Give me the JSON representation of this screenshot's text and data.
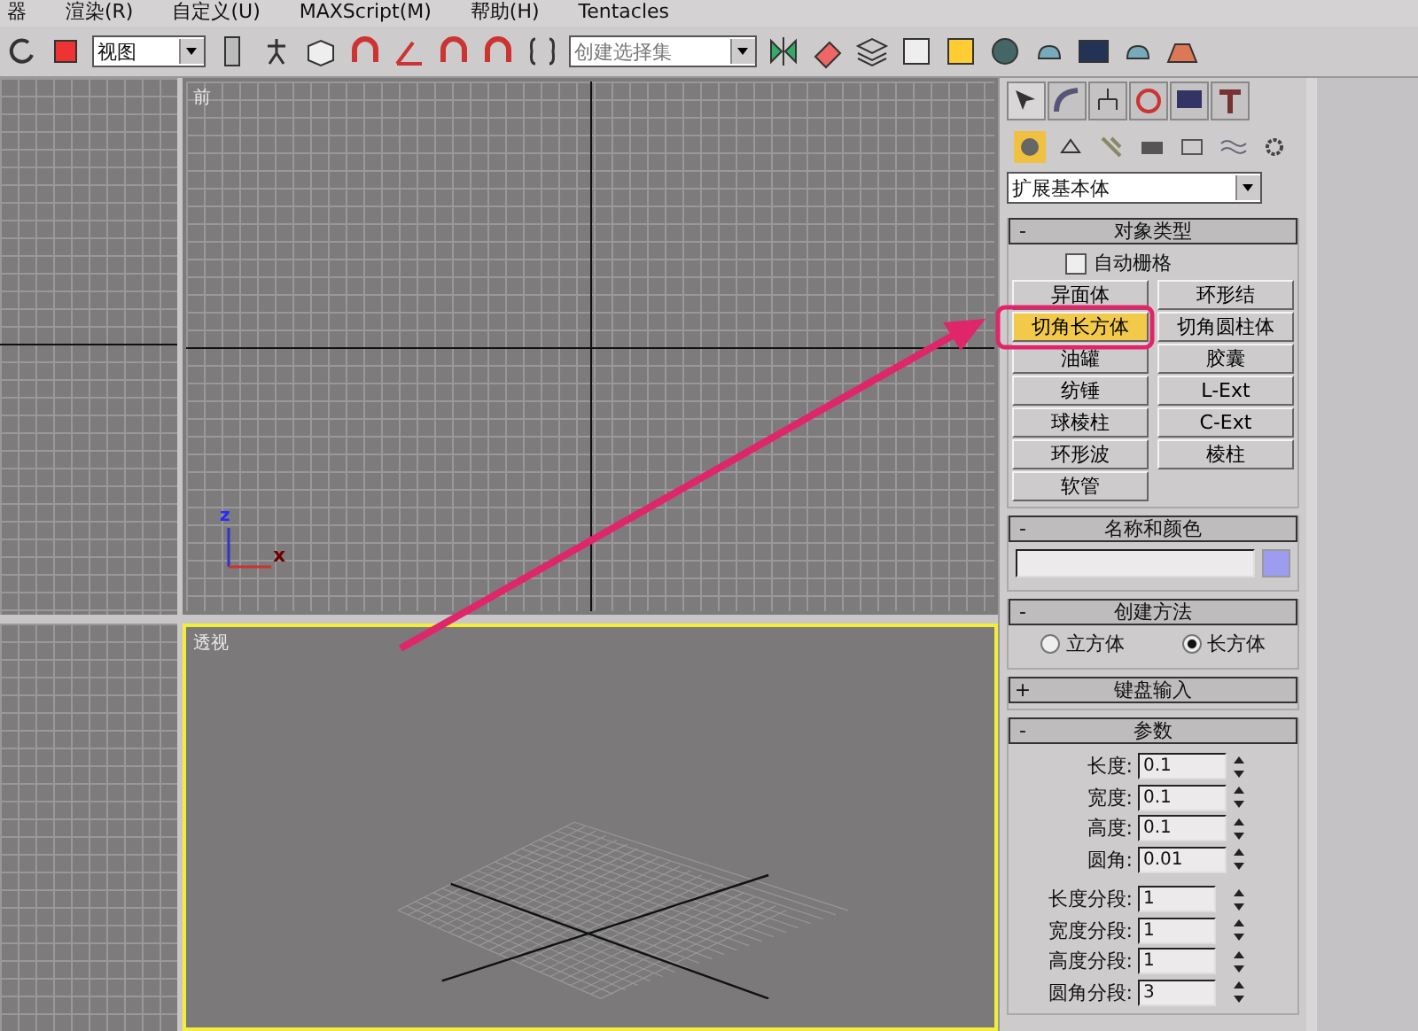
{
  "menu_bar": [
    "器",
    "渲染(R)",
    "自定义(U)",
    "MAXScript(M)",
    "帮助(H)",
    "Tentacles"
  ],
  "toolbar": {
    "view_dropdown": "视图",
    "selection_set_placeholder": "创建选择集"
  },
  "viewports": [
    {
      "label": "前",
      "active": false,
      "axis_labels": [
        "z",
        "x"
      ]
    },
    {
      "label": "透视",
      "active": true
    }
  ],
  "command_panel": {
    "tabs": [
      {
        "selected": true
      },
      {
        "selected": false
      },
      {
        "selected": false
      },
      {
        "selected": false
      },
      {
        "selected": false
      },
      {
        "selected": false
      }
    ],
    "categories": [
      {
        "selected": true
      },
      {
        "selected": false
      },
      {
        "selected": false
      },
      {
        "selected": false
      },
      {
        "selected": false
      },
      {
        "selected": false
      },
      {
        "selected": false
      }
    ],
    "dropdown": "扩展基本体",
    "rollouts": [
      {
        "kind": "object_type",
        "toggle": "-",
        "title": "对象类型",
        "autogrid": {
          "label": "自动栅格",
          "checked": false
        },
        "buttons": [
          {
            "label": "异面体",
            "selected": false
          },
          {
            "label": "环形结",
            "selected": false
          },
          {
            "label": "切角长方体",
            "selected": true
          },
          {
            "label": "切角圆柱体",
            "selected": false
          },
          {
            "label": "油罐",
            "selected": false
          },
          {
            "label": "胶囊",
            "selected": false
          },
          {
            "label": "纺锤",
            "selected": false
          },
          {
            "label": "L-Ext",
            "selected": false
          },
          {
            "label": "球棱柱",
            "selected": false
          },
          {
            "label": "C-Ext",
            "selected": false
          },
          {
            "label": "环形波",
            "selected": false
          },
          {
            "label": "棱柱",
            "selected": false
          },
          {
            "label": "软管",
            "selected": false
          }
        ]
      },
      {
        "kind": "name_color",
        "toggle": "-",
        "title": "名称和颜色",
        "color": "#9c9cf0"
      },
      {
        "kind": "creation_method",
        "toggle": "-",
        "title": "创建方法",
        "options": [
          {
            "label": "立方体",
            "selected": false
          },
          {
            "label": "长方体",
            "selected": true
          }
        ]
      },
      {
        "kind": "collapsed",
        "toggle": "+",
        "title": "键盘输入"
      },
      {
        "kind": "parameters",
        "toggle": "-",
        "title": "参数",
        "fields": [
          {
            "label": "长度:",
            "value": "0.1"
          },
          {
            "label": "宽度:",
            "value": "0.1"
          },
          {
            "label": "高度:",
            "value": "0.1"
          },
          {
            "label": "圆角:",
            "value": "0.01"
          }
        ],
        "segments": [
          {
            "label": "长度分段:",
            "value": "1"
          },
          {
            "label": "宽度分段:",
            "value": "1"
          },
          {
            "label": "高度分段:",
            "value": "1"
          },
          {
            "label": "圆角分段:",
            "value": "3"
          }
        ]
      }
    ]
  }
}
